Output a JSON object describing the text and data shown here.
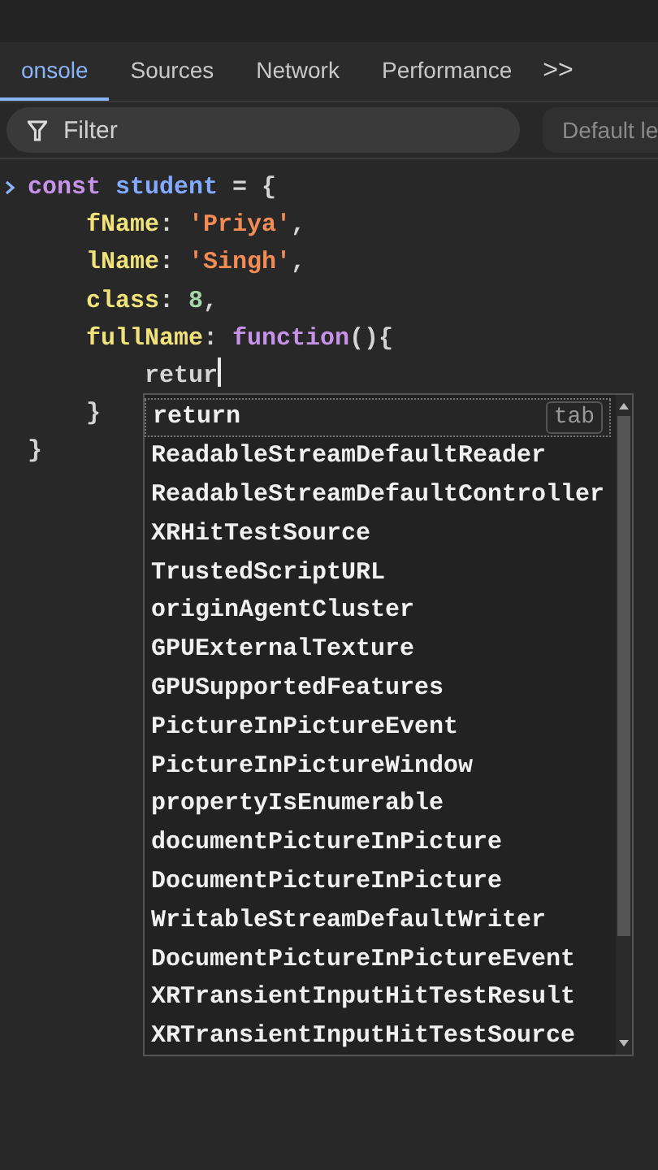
{
  "tabs": [
    {
      "label": "onsole",
      "selected": true
    },
    {
      "label": "Sources",
      "selected": false
    },
    {
      "label": "Network",
      "selected": false
    },
    {
      "label": "Performance",
      "selected": false
    }
  ],
  "more_tabs": ">>",
  "filter": {
    "placeholder": "Filter"
  },
  "levels_dropdown": {
    "label": "Default le"
  },
  "console": {
    "lines": [
      {
        "tokens": [
          {
            "kind": "keyword",
            "text": "const"
          },
          {
            "kind": "name",
            "text": " student"
          },
          {
            "kind": "plain",
            "text": " = {"
          }
        ],
        "children": [
          {
            "tokens": [
              {
                "kind": "property",
                "text": "fName"
              },
              {
                "kind": "plain",
                "text": ": "
              },
              {
                "kind": "string",
                "text": "'Priya'"
              },
              {
                "kind": "plain",
                "text": ","
              }
            ]
          },
          {
            "tokens": [
              {
                "kind": "property",
                "text": "lName"
              },
              {
                "kind": "plain",
                "text": ": "
              },
              {
                "kind": "string",
                "text": "'Singh'"
              },
              {
                "kind": "plain",
                "text": ","
              }
            ]
          },
          {
            "tokens": [
              {
                "kind": "property",
                "text": "class"
              },
              {
                "kind": "plain",
                "text": ": "
              },
              {
                "kind": "number",
                "text": "8"
              },
              {
                "kind": "plain",
                "text": ","
              }
            ]
          },
          {
            "tokens": [
              {
                "kind": "property",
                "text": "fullName"
              },
              {
                "kind": "plain",
                "text": ": "
              },
              {
                "kind": "keyword",
                "text": "function"
              },
              {
                "kind": "plain",
                "text": "(){"
              }
            ],
            "children": [
              {
                "tokens": [
                  {
                    "kind": "plain",
                    "text": "retur"
                  }
                ],
                "cursor": true
              }
            ],
            "closing": "}"
          }
        ],
        "closing": "}"
      }
    ]
  },
  "autocomplete": {
    "items": [
      {
        "label": "return",
        "selected": true,
        "hint": "tab"
      },
      {
        "label": "ReadableStreamDefaultReader",
        "selected": false
      },
      {
        "label": "ReadableStreamDefaultController",
        "selected": false
      },
      {
        "label": "XRHitTestSource",
        "selected": false
      },
      {
        "label": "TrustedScriptURL",
        "selected": false
      },
      {
        "label": "originAgentCluster",
        "selected": false
      },
      {
        "label": "GPUExternalTexture",
        "selected": false
      },
      {
        "label": "GPUSupportedFeatures",
        "selected": false
      },
      {
        "label": "PictureInPictureEvent",
        "selected": false
      },
      {
        "label": "PictureInPictureWindow",
        "selected": false
      },
      {
        "label": "propertyIsEnumerable",
        "selected": false
      },
      {
        "label": "documentPictureInPicture",
        "selected": false
      },
      {
        "label": "DocumentPictureInPicture",
        "selected": false
      },
      {
        "label": "WritableStreamDefaultWriter",
        "selected": false
      },
      {
        "label": "DocumentPictureInPictureEvent",
        "selected": false
      },
      {
        "label": "XRTransientInputHitTestResult",
        "selected": false
      },
      {
        "label": "XRTransientInputHitTestSource",
        "selected": false
      }
    ]
  }
}
